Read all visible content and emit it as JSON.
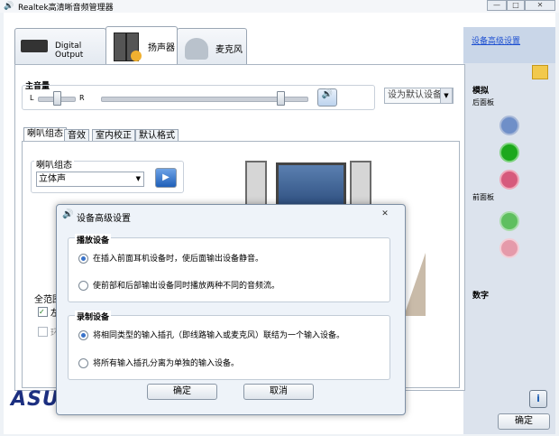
{
  "window": {
    "title": "Realtek高清晰音频管理器"
  },
  "tabs": [
    {
      "label": "Digital Output"
    },
    {
      "label": "扬声器"
    },
    {
      "label": "麦克风"
    }
  ],
  "right_panel": {
    "advanced_link": "设备高级设置",
    "analog_label": "模拟",
    "rear_panel_label": "后面板",
    "front_panel_label": "前面板",
    "digital_label": "数字",
    "rear_jacks": [
      "#6f8fc8",
      "#1ca81c",
      "#d65a7c"
    ],
    "front_jacks": [
      "#5fbf5f",
      "#e59aaa"
    ]
  },
  "volume": {
    "label": "主音量",
    "left": "L",
    "right": "R",
    "default_device_select": "设为默认设备"
  },
  "subtabs": [
    "喇叭组态",
    "音效",
    "室内校正",
    "默认格式"
  ],
  "speaker_config": {
    "label": "喇叭组态",
    "value": "立体声"
  },
  "full_range": {
    "label": "全范围",
    "checkbox1": "左",
    "checkbox2": "环"
  },
  "logo": "ASUS",
  "ok_button": "确定",
  "dialog": {
    "title": "设备高级设置",
    "playback_group": "播放设备",
    "playback_opt1": "在插入前面耳机设备时，使后面输出设备静音。",
    "playback_opt2": "使前部和后部输出设备同时播放两种不同的音频流。",
    "record_group": "录制设备",
    "record_opt1": "将相同类型的输入插孔（即线路输入或麦克风）联结为一个输入设备。",
    "record_opt2": "将所有输入插孔分离为单独的输入设备。",
    "ok": "确定",
    "cancel": "取消"
  }
}
